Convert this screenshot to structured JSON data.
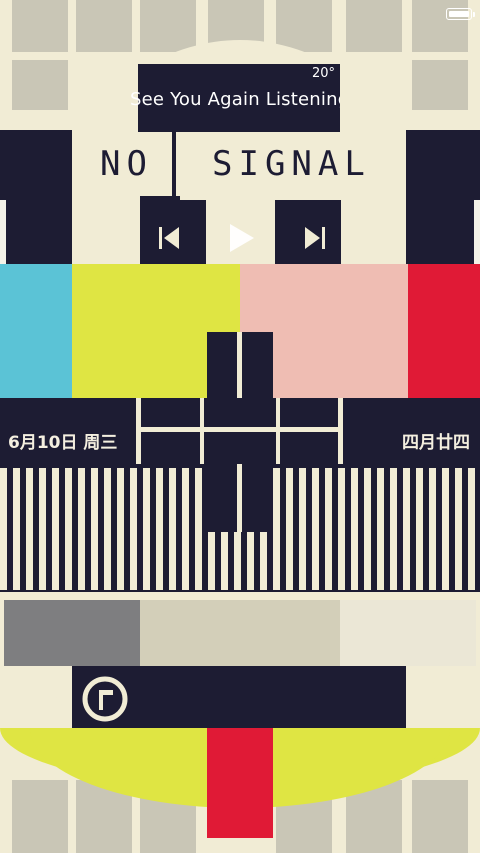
{
  "status": {
    "battery_level": 0.95
  },
  "weather": {
    "temp": "20°"
  },
  "music": {
    "ticker": "See You Again   Listening"
  },
  "poster": {
    "signal_left": "NO",
    "signal_right": "SIGNAL"
  },
  "date": {
    "solar": "6月10日 周三",
    "lunar": "四月廿四"
  },
  "icons": {
    "prev": "skip-previous-icon",
    "play": "play-icon",
    "next": "skip-next-icon",
    "unlock": "unlock-ring-icon"
  },
  "colors": {
    "navy": "#1d1c33",
    "cream": "#f1ecd5",
    "cyan": "#5bc3d6",
    "yellow": "#dfe543",
    "pink": "#efbdb3",
    "red": "#e01a36",
    "gray": "#7e7e80",
    "sand": "#d3cfb9"
  }
}
